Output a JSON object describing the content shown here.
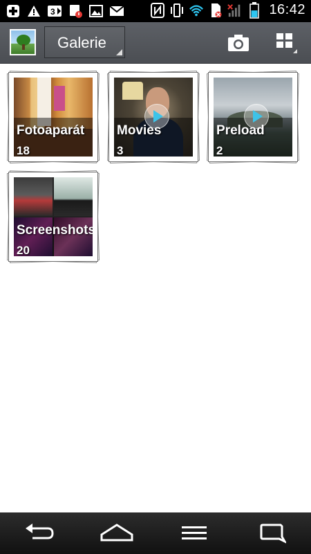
{
  "status_bar": {
    "time": "16:42",
    "icons_left": [
      "plus-box-icon",
      "warning-icon",
      "3g-icon",
      "notification-alert-icon",
      "gallery-icon",
      "mail-icon"
    ],
    "icons_right": [
      "nfc-icon",
      "vibrate-icon",
      "wifi-icon",
      "no-sim-icon",
      "signal-icon",
      "battery-icon"
    ],
    "battery_level": 0.55,
    "battery_color": "#2ec6f1"
  },
  "action_bar": {
    "title": "Galerie"
  },
  "albums": [
    {
      "name": "Fotoaparát",
      "count": "18"
    },
    {
      "name": "Movies",
      "count": "3"
    },
    {
      "name": "Preload",
      "count": "2"
    },
    {
      "name": "Screenshots",
      "count": "20"
    }
  ],
  "colors": {
    "accent": "#3ec3e8",
    "action_bar": "#55585d",
    "background": "#ffffff"
  }
}
